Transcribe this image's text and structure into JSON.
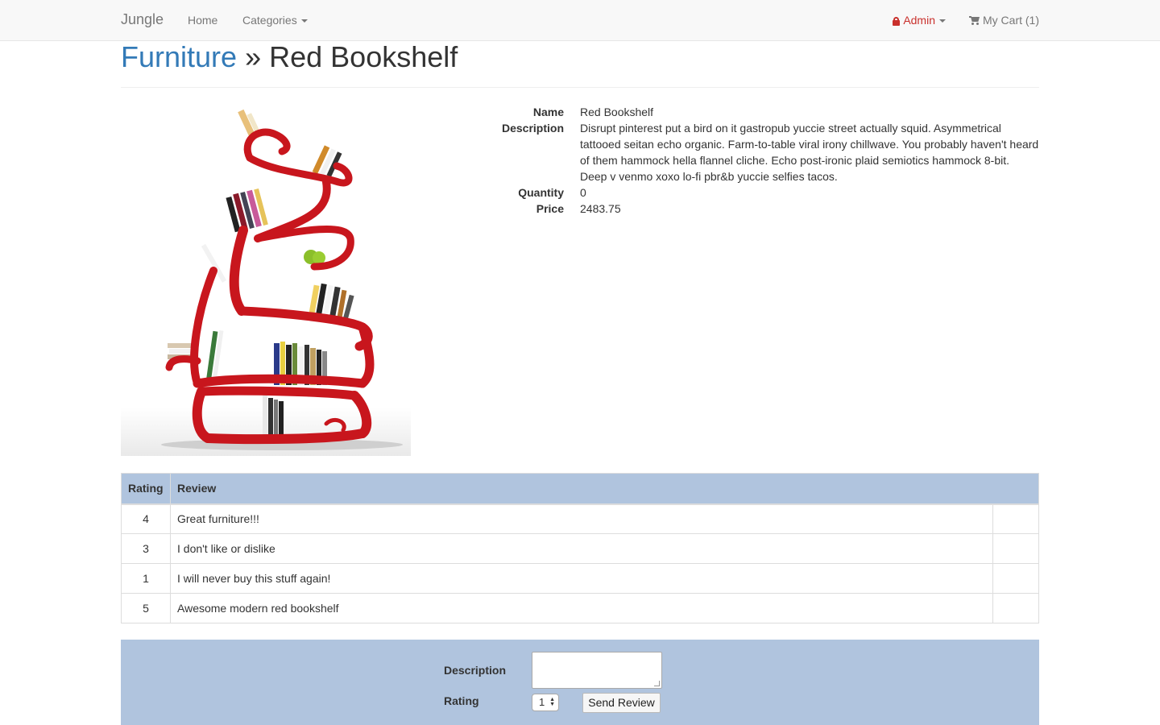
{
  "navbar": {
    "brand": "Jungle",
    "home": "Home",
    "categories": "Categories",
    "admin": "Admin",
    "cart": "My Cart (1)"
  },
  "header": {
    "category": "Furniture",
    "separator": "»",
    "product": "Red Bookshelf"
  },
  "product": {
    "name_label": "Name",
    "name": "Red Bookshelf",
    "description_label": "Description",
    "description": "Disrupt pinterest put a bird on it gastropub yuccie street actually squid. Asymmetrical tattooed seitan echo organic. Farm-to-table viral irony chillwave. You probably haven't heard of them hammock hella flannel cliche. Echo post-ironic plaid semiotics hammock 8-bit. Deep v venmo xoxo lo-fi pbr&b yuccie selfies tacos.",
    "quantity_label": "Quantity",
    "quantity": "0",
    "price_label": "Price",
    "price": "2483.75"
  },
  "reviews": {
    "headers": {
      "rating": "Rating",
      "review": "Review"
    },
    "rows": [
      {
        "rating": "4",
        "review": "Great furniture!!!"
      },
      {
        "rating": "3",
        "review": "I don't like or dislike"
      },
      {
        "rating": "1",
        "review": "I will never buy this stuff again!"
      },
      {
        "rating": "5",
        "review": "Awesome modern red bookshelf"
      }
    ]
  },
  "form": {
    "description_label": "Description",
    "description_value": "",
    "rating_label": "Rating",
    "rating_value": "1",
    "submit": "Send Review"
  },
  "colors": {
    "accent": "#337ab7",
    "admin": "#c9302c",
    "table_header": "#b0c4de",
    "shelf_red": "#c8161d"
  },
  "icons": {
    "admin": "lock-icon",
    "cart": "shopping-cart-icon"
  }
}
